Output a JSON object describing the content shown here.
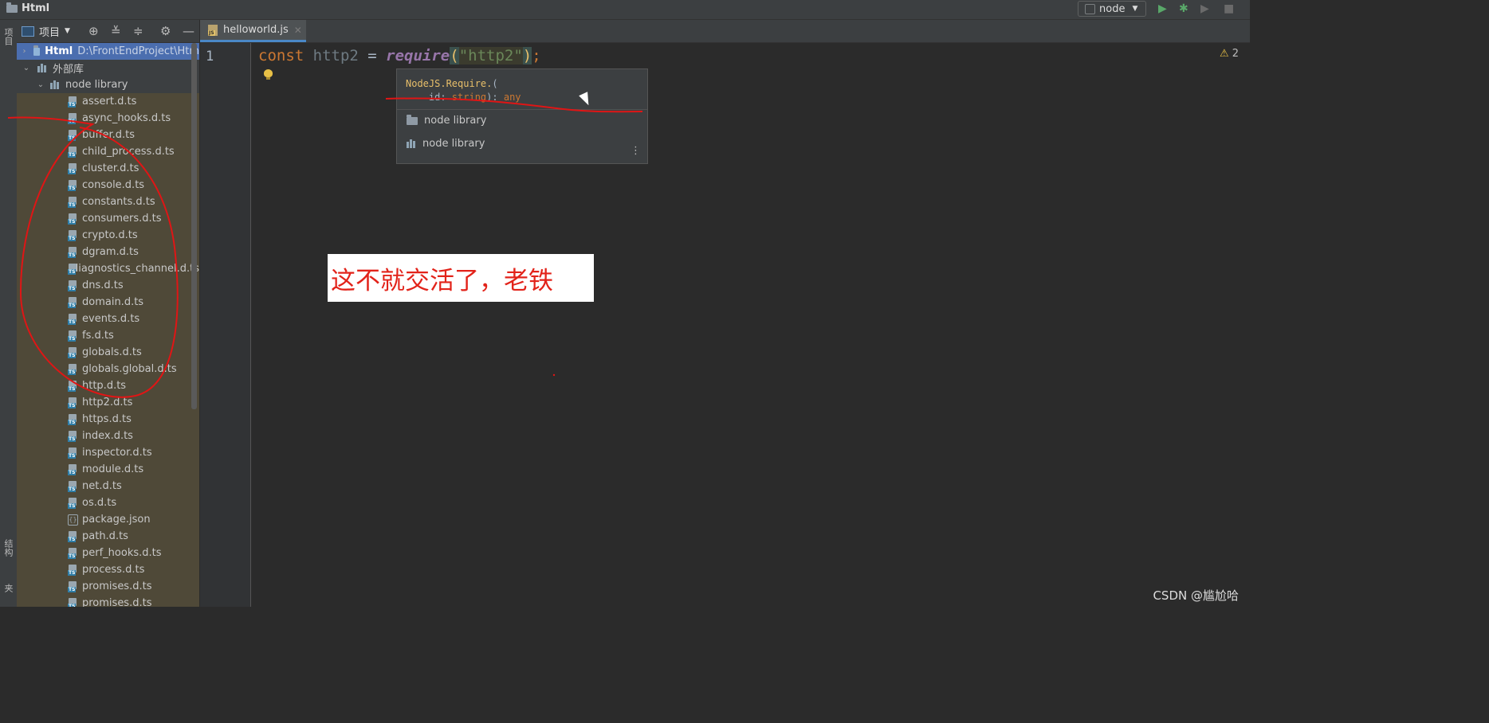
{
  "window": {
    "title": "Html"
  },
  "toolbar": {
    "run_config": "node"
  },
  "left_strip": {
    "top_label": "项目",
    "bottom_label_1": "结构",
    "bottom_label_2": "收藏夹"
  },
  "project_panel": {
    "title": "项目"
  },
  "tree": {
    "root": {
      "name": "Html",
      "path": "D:\\FrontEndProject\\Htm"
    },
    "external": "外部库",
    "node_library": "node library",
    "files": [
      "assert.d.ts",
      "async_hooks.d.ts",
      "buffer.d.ts",
      "child_process.d.ts",
      "cluster.d.ts",
      "console.d.ts",
      "constants.d.ts",
      "consumers.d.ts",
      "crypto.d.ts",
      "dgram.d.ts",
      "diagnostics_channel.d.ts",
      "dns.d.ts",
      "domain.d.ts",
      "events.d.ts",
      "fs.d.ts",
      "globals.d.ts",
      "globals.global.d.ts",
      "http.d.ts",
      "http2.d.ts",
      "https.d.ts",
      "index.d.ts",
      "inspector.d.ts",
      "module.d.ts",
      "net.d.ts",
      "os.d.ts",
      "package.json",
      "path.d.ts",
      "perf_hooks.d.ts",
      "process.d.ts",
      "promises.d.ts",
      "promises.d.ts"
    ]
  },
  "editor": {
    "tab": "helloworld.js",
    "line_number": "1",
    "code": {
      "kw": "const",
      "var": " http2",
      "eq": " = ",
      "fn": "require",
      "open": "(",
      "str": "\"http2\"",
      "close": ")",
      "semi": ";"
    },
    "warnings": "2"
  },
  "popup": {
    "sig_ns": "NodeJS.Require.",
    "sig_open": "(",
    "sig_param": "    id: ",
    "sig_ptype": "string",
    "sig_mid": "): ",
    "sig_ret": "any",
    "items": [
      "node library",
      "node library"
    ],
    "more": "⋮"
  },
  "annotation": "这不就交活了，老铁",
  "watermark": "CSDN @尴尬哈"
}
